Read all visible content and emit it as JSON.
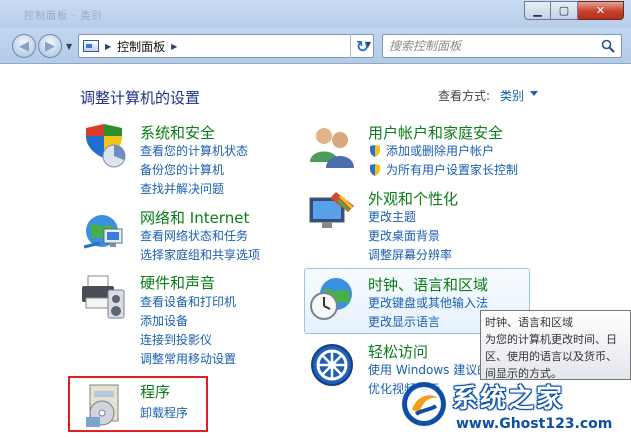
{
  "window": {
    "caption": "控制面板 · 类别",
    "buttons": {
      "minimize": "▁",
      "maximize": "▢",
      "close": "✕"
    }
  },
  "nav": {
    "back": "◀",
    "forward": "▶",
    "history": "▼",
    "breadcrumb": [
      "控制面板"
    ],
    "refresh": "↻",
    "search_placeholder": "搜索控制面板"
  },
  "main": {
    "title": "调整计算机的设置",
    "view_by_label": "查看方式:",
    "view_by_value": "类别"
  },
  "categories": [
    {
      "title": "系统和安全",
      "icon": "shield-pie-icon",
      "links": [
        "查看您的计算机状态",
        "备份您的计算机",
        "查找并解决问题"
      ]
    },
    {
      "title": "网络和 Internet",
      "icon": "globe-network-icon",
      "links": [
        "查看网络状态和任务",
        "选择家庭组和共享选项"
      ]
    },
    {
      "title": "硬件和声音",
      "icon": "printer-speaker-icon",
      "links": [
        "查看设备和打印机",
        "添加设备",
        "连接到投影仪",
        "调整常用移动设置"
      ]
    },
    {
      "title": "程序",
      "icon": "programs-icon",
      "links": [
        "卸载程序"
      ]
    },
    {
      "title": "用户帐户和家庭安全",
      "icon": "users-icon",
      "links": [
        "添加或删除用户帐户",
        "为所有用户设置家长控制"
      ]
    },
    {
      "title": "外观和个性化",
      "icon": "monitor-palette-icon",
      "links": [
        "更改主题",
        "更改桌面背景",
        "调整屏幕分辨率"
      ]
    },
    {
      "title": "时钟、语言和区域",
      "icon": "clock-globe-icon",
      "links": [
        "更改键盘或其他输入法",
        "更改显示语言"
      ]
    },
    {
      "title": "轻松访问",
      "icon": "ease-of-access-icon",
      "links": [
        "使用 Windows 建议的",
        "优化视频显示"
      ]
    }
  ],
  "tooltip": {
    "lines": [
      "时钟、语言和区域",
      "为您的计算机更改时间、日",
      "区、使用的语言以及货币、",
      "间显示的方式。"
    ]
  },
  "watermark": {
    "title": "系统之家",
    "url": "www.Ghost123.com"
  },
  "colors": {
    "category_title": "#0a7d18",
    "link": "#1a5fb4",
    "page_title": "#1e3287",
    "highlight": "#e02020"
  }
}
